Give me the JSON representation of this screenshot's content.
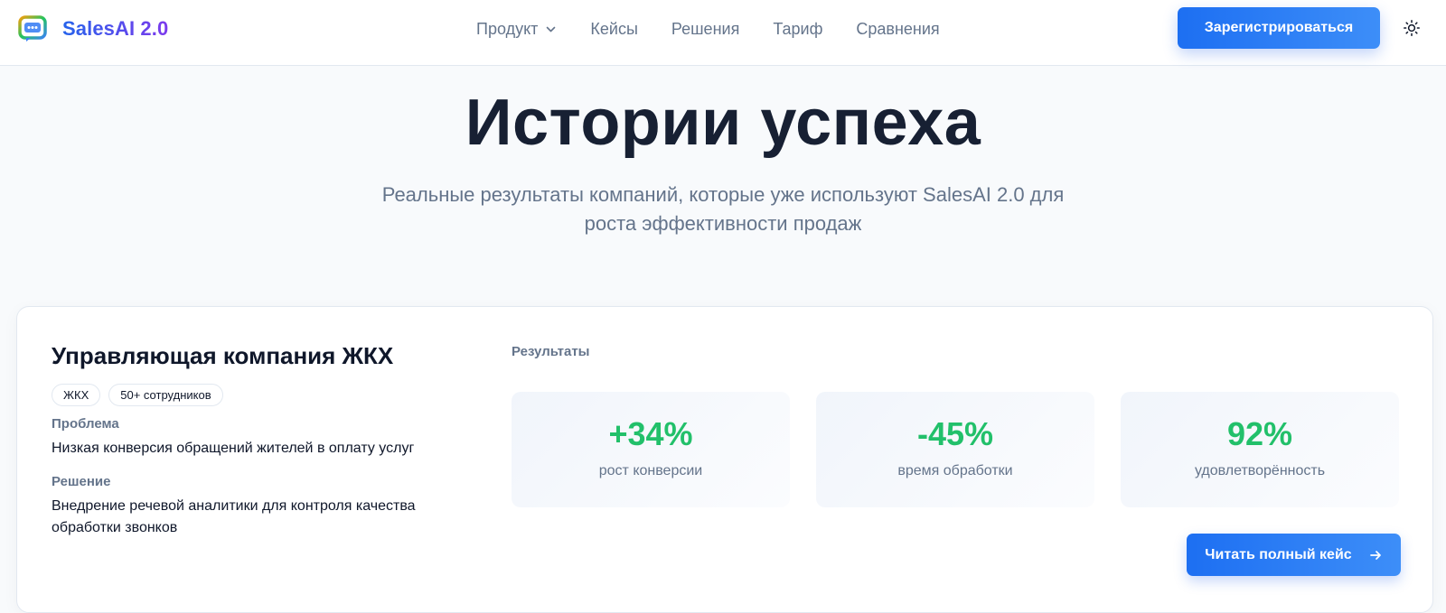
{
  "header": {
    "logo_text": "SalesAI 2.0",
    "logo_icon": "chat-bubble-icon",
    "nav": [
      {
        "label": "Продукт",
        "has_dropdown": true
      },
      {
        "label": "Кейсы"
      },
      {
        "label": "Решения"
      },
      {
        "label": "Тариф"
      },
      {
        "label": "Сравнения"
      }
    ],
    "signup_label": "Зарегистрироваться",
    "theme_icon": "sun-icon"
  },
  "hero": {
    "title": "Истории успеха",
    "subtitle_line1": "Реальные результаты компаний, которые уже используют SalesAI 2.0 для",
    "subtitle_line2": "роста эффективности продаж"
  },
  "case": {
    "title": "Управляющая компания ЖКХ",
    "tags": [
      "ЖКХ",
      "50+ сотрудников"
    ],
    "problem_label": "Проблема",
    "problem_text": "Низкая конверсия обращений жителей в оплату услуг",
    "solution_label": "Решение",
    "solution_text_line1": "Внедрение речевой аналитики для контроля качества",
    "solution_text_line2": "обработки звонков",
    "results_label": "Результаты",
    "metrics": [
      {
        "value": "+34%",
        "label": "рост конверсии"
      },
      {
        "value": "-45%",
        "label": "время обработки"
      },
      {
        "value": "92%",
        "label": "удовлетворённость"
      }
    ],
    "read_button_label": "Читать полный кейс"
  },
  "colors": {
    "accent_blue": "#1d6ff2",
    "metric_green": "#22c06a",
    "muted_text": "#64748b",
    "heading_text": "#0f172a"
  }
}
